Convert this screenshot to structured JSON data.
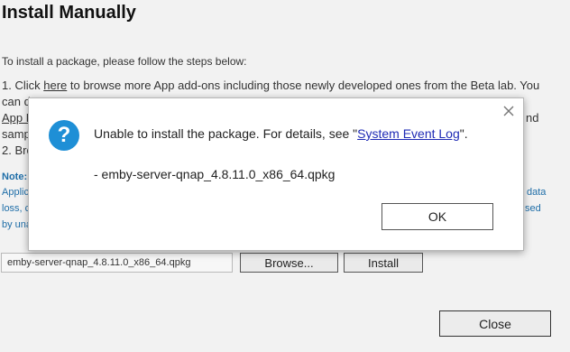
{
  "dialog": {
    "title": "Install Manually",
    "intro": "To install a package, please follow the steps below:",
    "step1_prefix": "1. Click ",
    "step1_link": "here",
    "step1_suffix": " to browse more App add-ons including those newly developed ones from the Beta lab. You",
    "step1_line2": "can d",
    "step1_line3": "App D",
    "step1_line3_right": "nd",
    "step1_line4": "samp",
    "step2": "2. Bro",
    "note_label": "Note:",
    "note_line1": "Applic",
    "note_line1_right": "data",
    "note_line2": "loss, c",
    "note_line2_right": "sed",
    "note_line3": "by una",
    "file_value": "emby-server-qnap_4.8.11.0_x86_64.qpkg",
    "browse_label": "Browse...",
    "install_label": "Install",
    "close_label": "Close"
  },
  "alert": {
    "message_prefix": "Unable to install the package. For details, see \"",
    "message_link": "System Event Log",
    "message_suffix": "\".",
    "package": "- emby-server-qnap_4.8.11.0_x86_64.qpkg",
    "ok_label": "OK",
    "icon": "question-icon",
    "icon_color": "#1e8fd6"
  }
}
